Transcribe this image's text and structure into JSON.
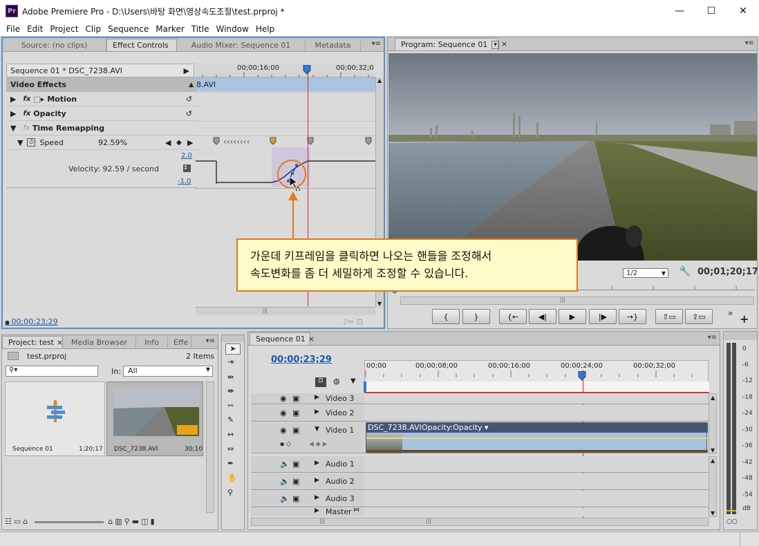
{
  "window": {
    "app_icon": "Pr",
    "title": "Adobe Premiere Pro - D:\\Users\\바탕 화면\\영상속도조절\\test.prproj *"
  },
  "menu": [
    "File",
    "Edit",
    "Project",
    "Clip",
    "Sequence",
    "Marker",
    "Title",
    "Window",
    "Help"
  ],
  "top_left_tabs": [
    "Source: (no clips)",
    "Effect Controls",
    "Audio Mixer: Sequence 01",
    "Metadata"
  ],
  "effect_controls": {
    "clip_label": "Sequence 01 * DSC_7238.AVI",
    "ruler": [
      "00;00;16;00",
      "00;00;32;0"
    ],
    "clip_bar_text": "8.AVI",
    "video_effects": "Video Effects",
    "motion": "Motion",
    "opacity": "Opacity",
    "time_remapping": "Time Remapping",
    "speed_label": "Speed",
    "speed_value": "92.59%",
    "scale_top": "2.0",
    "scale_bottom": "-1.0",
    "velocity": "Velocity: 92.59 / second",
    "timecode": "00;00;23;29"
  },
  "program": {
    "tab": "Program: Sequence 01",
    "zoom": "1/2",
    "timecode": "00;01;20;17"
  },
  "callout": {
    "line1": "가운데 키프레임을 클릭하면 나오는 핸들을 조정해서",
    "line2": "속도변화를 좀 더 세밀하게 조정할 수 있습니다."
  },
  "transport": [
    "{",
    "}",
    "{←",
    "◀|",
    "▶",
    "|▶",
    "→}",
    "",
    ""
  ],
  "project": {
    "tabs": [
      "Project: test",
      "Media Browser",
      "Info",
      "Effe"
    ],
    "file": "test.prproj",
    "items": "2 Items",
    "in_label": "In:",
    "in_value": "All",
    "bins": [
      {
        "name": "Sequence 01",
        "duration": "1;20;17"
      },
      {
        "name": "DSC_7238.AVI",
        "duration": "30;10"
      }
    ]
  },
  "timeline": {
    "tab": "Sequence 01",
    "timecode": "00;00;23;29",
    "ruler": [
      "00;00",
      "00;00;08;00",
      "00;00;16;00",
      "00;00;24;00",
      "00;00;32;00"
    ],
    "tracks_video": [
      "Video 3",
      "Video 2",
      "Video 1"
    ],
    "tracks_audio": [
      "Audio 1",
      "Audio 2",
      "Audio 3",
      "Master"
    ],
    "clip_name": "DSC_7238.AVI",
    "clip_fx": "Opacity:Opacity ▾"
  },
  "meter": {
    "labels": [
      "0",
      "-6",
      "-12",
      "-18",
      "-24",
      "-30",
      "-36",
      "-42",
      "-48",
      "-54",
      "dB"
    ]
  },
  "colors": {
    "accent_blue": "#1d57a8",
    "playhead": "#d22",
    "callout_bg": "#fffbc8",
    "callout_border": "#e07a1a",
    "clip_blue": "#a7c1de"
  }
}
